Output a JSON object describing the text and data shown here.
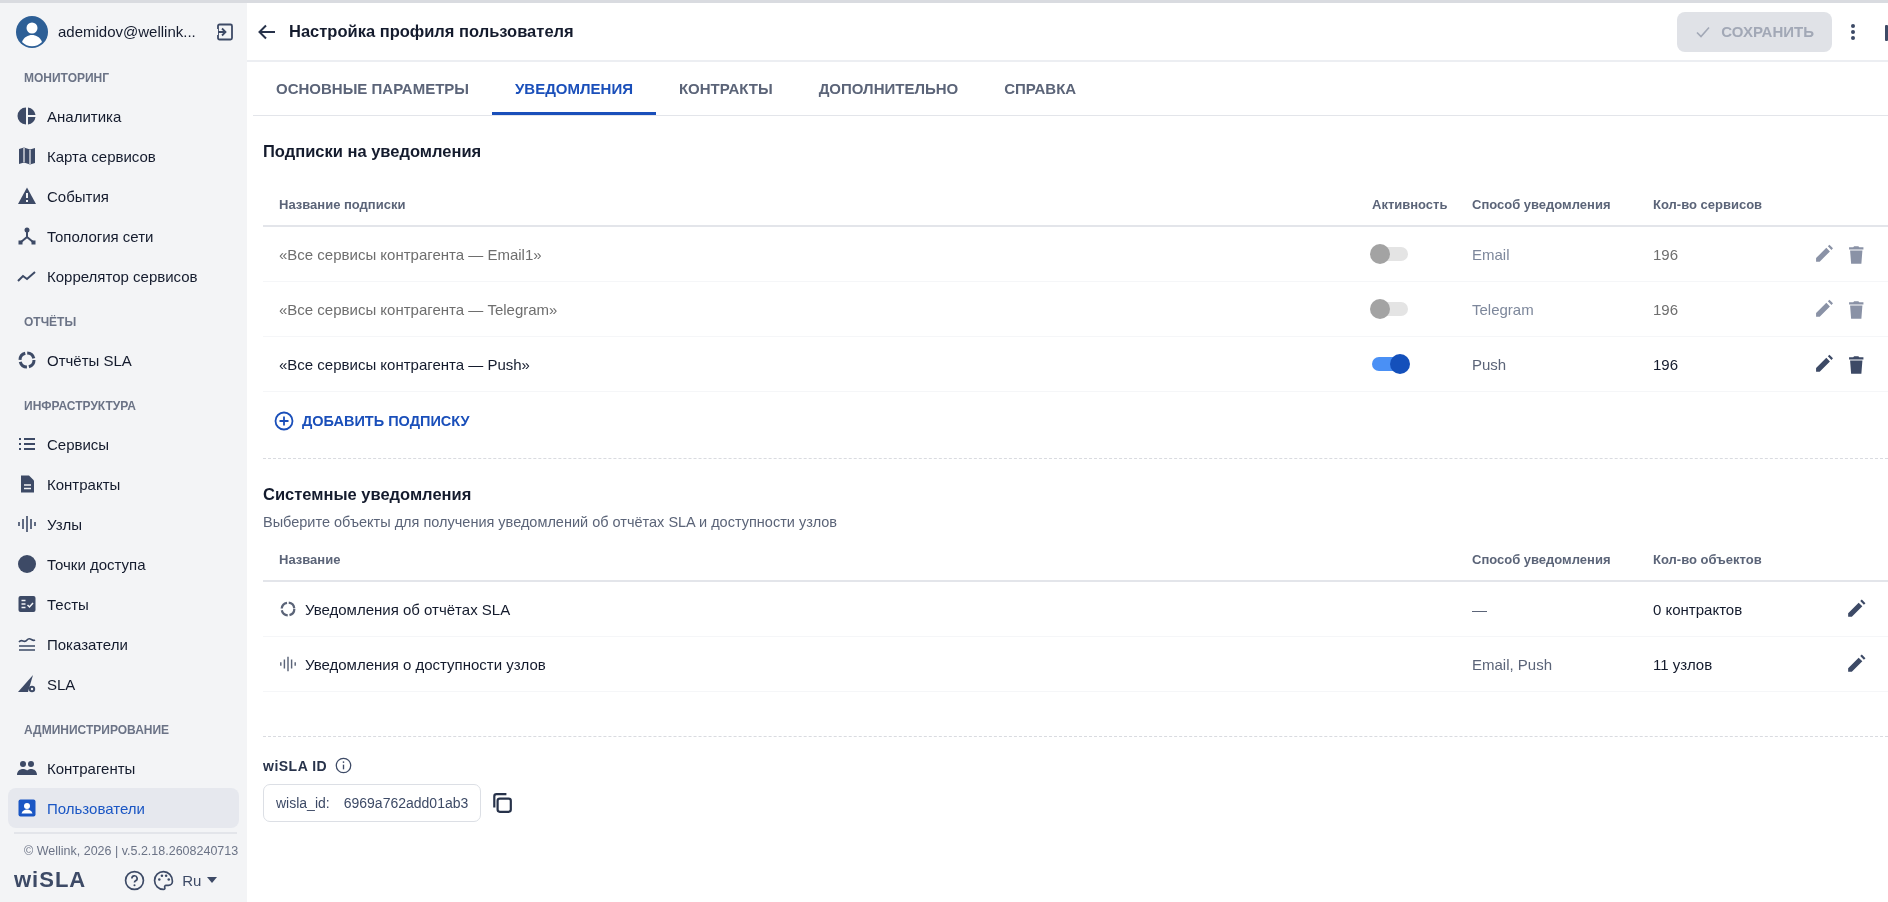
{
  "user": {
    "email": "ademidov@wellink..."
  },
  "sidebar": {
    "groups": [
      {
        "title": "МОНИТОРИНГ",
        "items": [
          {
            "label": "Аналитика",
            "selected": false
          },
          {
            "label": "Карта сервисов",
            "selected": false
          },
          {
            "label": "События",
            "selected": false
          },
          {
            "label": "Топология сети",
            "selected": false
          },
          {
            "label": "Коррелятор сервисов",
            "selected": false
          }
        ]
      },
      {
        "title": "ОТЧЁТЫ",
        "items": [
          {
            "label": "Отчёты SLA",
            "selected": false
          }
        ]
      },
      {
        "title": "ИНФРАСТРУКТУРА",
        "items": [
          {
            "label": "Сервисы",
            "selected": false
          },
          {
            "label": "Контракты",
            "selected": false
          },
          {
            "label": "Узлы",
            "selected": false
          },
          {
            "label": "Точки доступа",
            "selected": false
          },
          {
            "label": "Тесты",
            "selected": false
          },
          {
            "label": "Показатели",
            "selected": false
          },
          {
            "label": "SLA",
            "selected": false
          }
        ]
      },
      {
        "title": "АДМИНИСТРИРОВАНИЕ",
        "items": [
          {
            "label": "Контрагенты",
            "selected": false
          },
          {
            "label": "Пользователи",
            "selected": true
          }
        ]
      }
    ]
  },
  "footer": {
    "copyright": "© Wellink, 2026 | v.5.2.18.2608240713",
    "logo": "wiSLA",
    "language": "Ru"
  },
  "header": {
    "title": "Настройка профиля пользователя",
    "save_button": {
      "label": "СОХРАНИТЬ",
      "disabled": true
    }
  },
  "tabs": [
    {
      "label": "ОСНОВНЫЕ ПАРАМЕТРЫ",
      "selected": false
    },
    {
      "label": "УВЕДОМЛЕНИЯ",
      "selected": true
    },
    {
      "label": "КОНТРАКТЫ",
      "selected": false
    },
    {
      "label": "ДОПОЛНИТЕЛЬНО",
      "selected": false
    },
    {
      "label": "СПРАВКА",
      "selected": false
    }
  ],
  "subscriptions": {
    "title": "Подписки на уведомления",
    "columns": [
      "Название подписки",
      "Активность",
      "Способ уведомления",
      "Кол-во сервисов"
    ],
    "rows": [
      {
        "name": "«Все сервисы контрагента — Email1»",
        "active": false,
        "method": "Email",
        "count": "196"
      },
      {
        "name": "«Все сервисы контрагента — Telegram»",
        "active": false,
        "method": "Telegram",
        "count": "196"
      },
      {
        "name": "«Все сервисы контрагента — Push»",
        "active": true,
        "method": "Push",
        "count": "196"
      }
    ],
    "add_button": "ДОБАВИТЬ ПОДПИСКУ"
  },
  "system": {
    "title": "Системные уведомления",
    "description": "Выберите объекты для получения уведомлений об отчётах SLA и доступности узлов",
    "columns": [
      "Название",
      "Способ уведомления",
      "Кол-во объектов"
    ],
    "rows": [
      {
        "name": "Уведомления об отчётах SLA",
        "method": "—",
        "count": "0 контрактов"
      },
      {
        "name": "Уведомления о доступности узлов",
        "method": "Email, Push",
        "count": "11 узлов"
      }
    ]
  },
  "wisla_id": {
    "label": "wiSLA ID",
    "field_label": "wisla_id:",
    "value": "6969a762add01ab3"
  }
}
